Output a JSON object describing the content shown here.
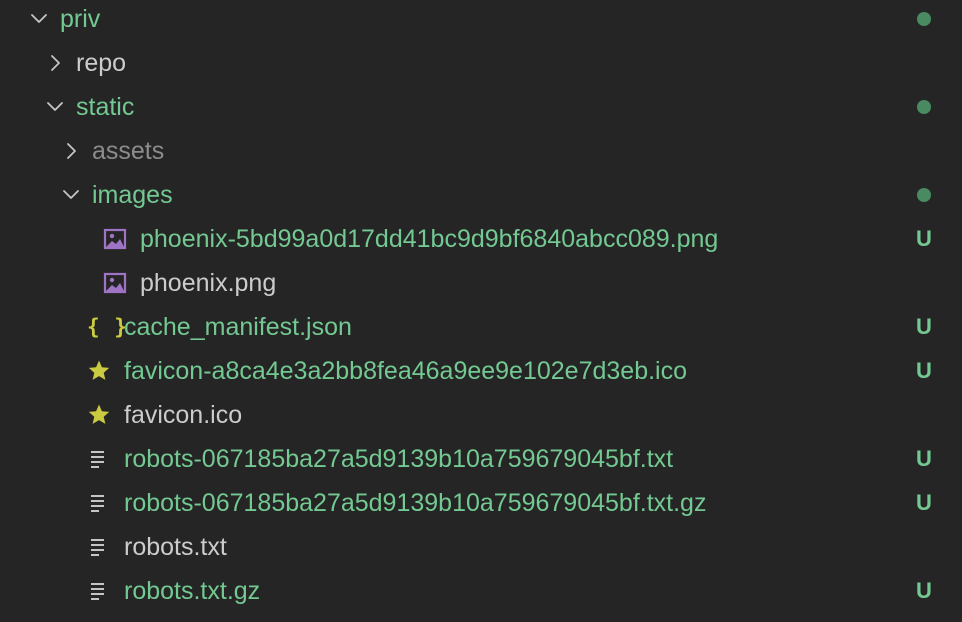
{
  "colors": {
    "background": "#252526",
    "untracked": "#73c991",
    "normal": "#cccccc",
    "ignored": "#8c8c8c",
    "chevron": "#c5c5c5",
    "status_dot": "#4a8a60",
    "image_icon": "#a074c4",
    "json_icon": "#cbcb41",
    "favicon_icon": "#cbcb41",
    "text_icon": "#c5c5c5"
  },
  "explorer": {
    "items": [
      {
        "name": "priv",
        "type": "folder",
        "expanded": true,
        "depth": 0,
        "status": "dot",
        "color": "untracked"
      },
      {
        "name": "repo",
        "type": "folder",
        "expanded": false,
        "depth": 1,
        "status": "",
        "color": "normal"
      },
      {
        "name": "static",
        "type": "folder",
        "expanded": true,
        "depth": 1,
        "status": "dot",
        "color": "untracked"
      },
      {
        "name": "assets",
        "type": "folder",
        "expanded": false,
        "depth": 2,
        "status": "",
        "color": "ignored"
      },
      {
        "name": "images",
        "type": "folder",
        "expanded": true,
        "depth": 2,
        "status": "dot",
        "color": "untracked"
      },
      {
        "name": "phoenix-5bd99a0d17dd41bc9d9bf6840abcc089.png",
        "type": "file",
        "icon": "image",
        "depth": 3,
        "status": "U",
        "color": "untracked"
      },
      {
        "name": "phoenix.png",
        "type": "file",
        "icon": "image",
        "depth": 3,
        "status": "",
        "color": "normal"
      },
      {
        "name": "cache_manifest.json",
        "type": "file",
        "icon": "json",
        "icon_text": "{ }",
        "depth": 2,
        "status": "U",
        "color": "untracked"
      },
      {
        "name": "favicon-a8ca4e3a2bb8fea46a9ee9e102e7d3eb.ico",
        "type": "file",
        "icon": "star",
        "depth": 2,
        "status": "U",
        "color": "untracked"
      },
      {
        "name": "favicon.ico",
        "type": "file",
        "icon": "star",
        "depth": 2,
        "status": "",
        "color": "normal"
      },
      {
        "name": "robots-067185ba27a5d9139b10a759679045bf.txt",
        "type": "file",
        "icon": "text",
        "depth": 2,
        "status": "U",
        "color": "untracked"
      },
      {
        "name": "robots-067185ba27a5d9139b10a759679045bf.txt.gz",
        "type": "file",
        "icon": "text",
        "depth": 2,
        "status": "U",
        "color": "untracked"
      },
      {
        "name": "robots.txt",
        "type": "file",
        "icon": "text",
        "depth": 2,
        "status": "",
        "color": "normal"
      },
      {
        "name": "robots.txt.gz",
        "type": "file",
        "icon": "text",
        "depth": 2,
        "status": "U",
        "color": "untracked"
      }
    ]
  }
}
